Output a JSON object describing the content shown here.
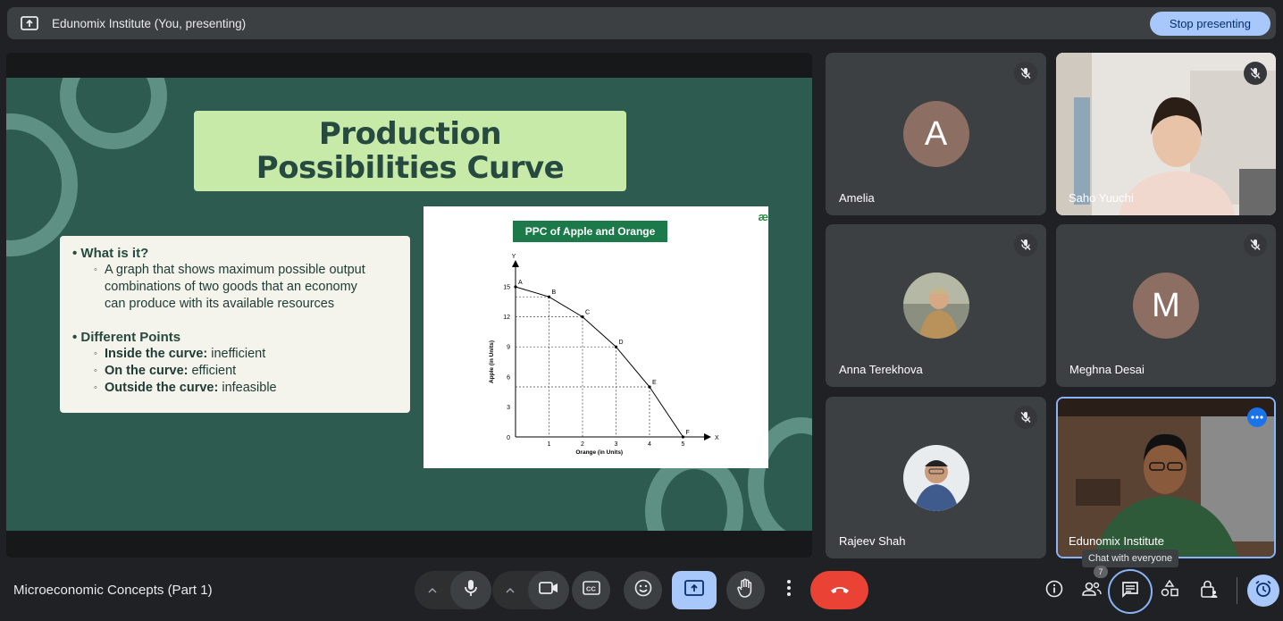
{
  "topbar": {
    "title": "Edunomix Institute (You, presenting)",
    "stop_label": "Stop presenting",
    "icon": "present-to-all-icon"
  },
  "slide": {
    "title_line1": "Production",
    "title_line2": "Possibilities Curve",
    "bullet1_heading": "What is it?",
    "bullet1_text_l1": "A graph that shows maximum possible output",
    "bullet1_text_l2": "combinations of two goods that an economy",
    "bullet1_text_l3": "can produce with its available resources",
    "bullet2_heading": "Different Points",
    "inside_label": "Inside the curve:",
    "inside_value": " inefficient",
    "on_label": "On the curve:",
    "on_value": " efficient",
    "outside_label": "Outside the curve:",
    "outside_value": " infeasible",
    "graph_title": "PPC of Apple and Orange",
    "gfg_logo": "æ",
    "graph": {
      "y_axis_letter": "Y",
      "x_axis_letter": "X",
      "ylabel": "Apple (in Units)",
      "xlabel": "Orange (in Units)",
      "origin": "0",
      "xticks": [
        "1",
        "2",
        "3",
        "4",
        "5"
      ],
      "yticks": [
        "3",
        "6",
        "9",
        "12",
        "15"
      ],
      "points": [
        {
          "label": "A",
          "x": 0,
          "y": 15
        },
        {
          "label": "B",
          "x": 1,
          "y": 14
        },
        {
          "label": "C",
          "x": 2,
          "y": 12
        },
        {
          "label": "D",
          "x": 3,
          "y": 9
        },
        {
          "label": "E",
          "x": 4,
          "y": 5
        },
        {
          "label": "F",
          "x": 5,
          "y": 0
        }
      ]
    }
  },
  "participants": [
    {
      "name": "Amelia",
      "initial": "A",
      "avatar_color": "#8d6e63"
    },
    {
      "name": "Saho Yuuchi"
    },
    {
      "name": "Anna Terekhova"
    },
    {
      "name": "Meghna Desai",
      "initial": "M",
      "avatar_color": "#8d6e63"
    },
    {
      "name": "Rajeev Shah"
    },
    {
      "name": "Edunomix Institute"
    }
  ],
  "bottom": {
    "meeting_name": "Microeconomic Concepts (Part 1)",
    "tooltip": "Chat with everyone",
    "people_count": "7"
  },
  "colors": {
    "accent": "#a8c7fa",
    "end_call": "#ea4335",
    "present_active": "#a8c7fa",
    "tile_bg": "#3c4043",
    "slide_bg": "#2e5b50"
  }
}
